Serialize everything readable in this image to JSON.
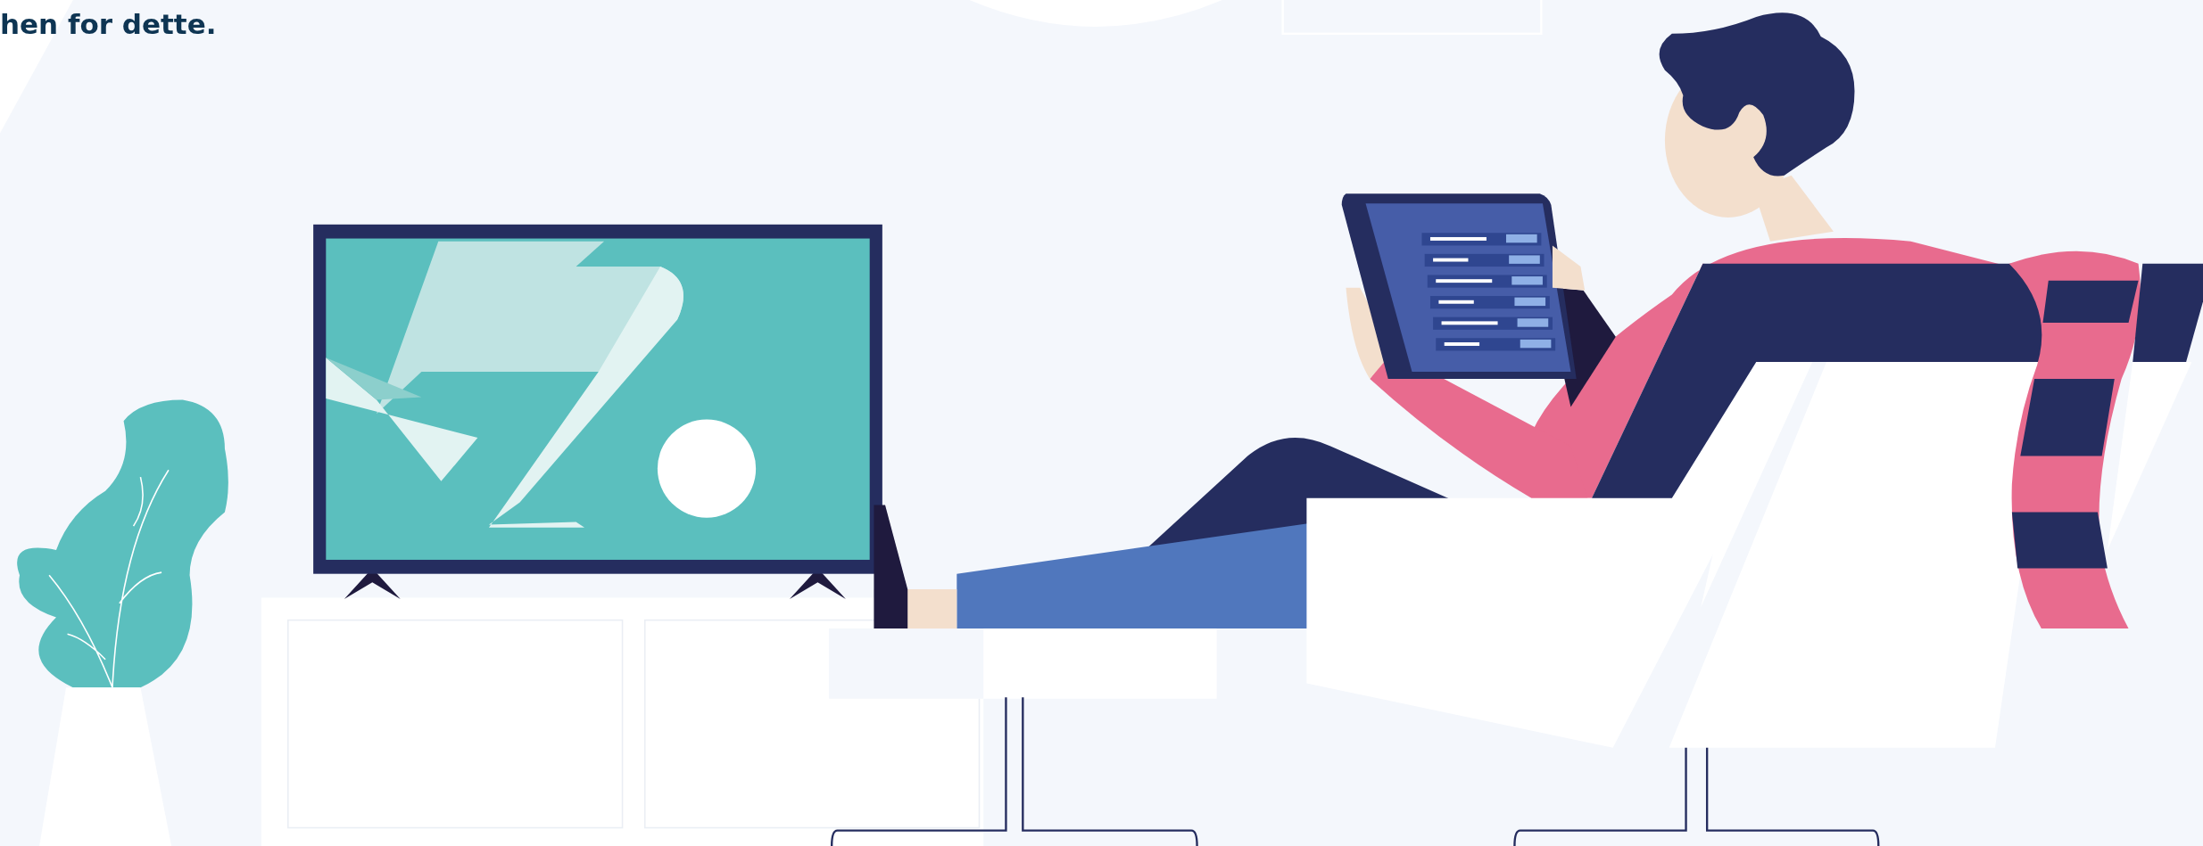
{
  "heading": {
    "text": "hen for dette."
  }
}
